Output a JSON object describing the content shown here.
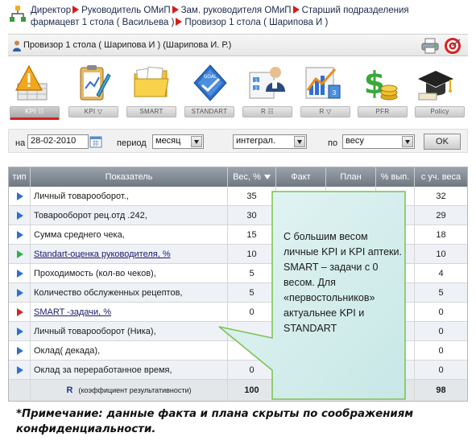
{
  "breadcrumb": {
    "items": [
      "Директор",
      "Руководитель ОМиП",
      "Зам. руководителя ОМиП",
      "Старший подразделения",
      "фармацевт 1 стола ( Васильева )",
      "Провизор 1 стола ( Шарипова И )"
    ]
  },
  "user": {
    "label": "Провизор 1 стола ( Шарипова И )  (Шарипова И. Р.)"
  },
  "modules": [
    "KPI",
    "KPI",
    "SMART",
    "STANDART",
    "R",
    "R",
    "PFR",
    "Policy"
  ],
  "tabs": [
    {
      "label": "KPI ☷",
      "active": true
    },
    {
      "label": "KPI ▽",
      "active": false
    },
    {
      "label": "SMART",
      "active": false
    },
    {
      "label": "STANDART",
      "active": false
    },
    {
      "label": "R ☷",
      "active": false
    },
    {
      "label": "R ▽",
      "active": false
    },
    {
      "label": "PFR",
      "active": false
    },
    {
      "label": "Policy",
      "active": false
    }
  ],
  "filters": {
    "date_label": "на",
    "date_value": "28-02-2010",
    "period_label": "период",
    "period_value": "месяц",
    "mode_value": "интеграл.",
    "by_label": "по",
    "by_value": "весу",
    "ok_label": "OK"
  },
  "table": {
    "headers": [
      "тип",
      "Показатель",
      "Вес, %",
      "Факт",
      "План",
      "% вып.",
      "с уч. веса"
    ],
    "rows": [
      {
        "type": "blue",
        "name": "Личный товарооборот.,",
        "weight": "35",
        "fact": "",
        "plan": "",
        "pct": "",
        "weighted": "32",
        "link": false
      },
      {
        "type": "blue",
        "name": "Товарооборот рец.отд .242,",
        "weight": "30",
        "fact": "",
        "plan": "",
        "pct": "",
        "weighted": "29",
        "link": false
      },
      {
        "type": "blue",
        "name": "Сумма среднего чека,",
        "weight": "15",
        "fact": "",
        "plan": "",
        "pct": "",
        "weighted": "18",
        "link": false
      },
      {
        "type": "green",
        "name": "Standart-оценка руководителя, %",
        "weight": "10",
        "fact": "",
        "plan": "",
        "pct": "",
        "weighted": "10",
        "link": true
      },
      {
        "type": "blue",
        "name": "Проходимость (кол-во чеков),",
        "weight": "5",
        "fact": "",
        "plan": "",
        "pct": "",
        "weighted": "4",
        "link": false
      },
      {
        "type": "blue",
        "name": "Количество обслуженных рецептов,",
        "weight": "5",
        "fact": "",
        "plan": "",
        "pct": "",
        "weighted": "5",
        "link": false
      },
      {
        "type": "red",
        "name": "SMART -задачи, %",
        "weight": "0",
        "fact": "",
        "plan": "",
        "pct": "",
        "weighted": "0",
        "link": true
      },
      {
        "type": "blue",
        "name": "Личный товарооборот (Ника),",
        "weight": "",
        "fact": "",
        "plan": "",
        "pct": "",
        "weighted": "0",
        "link": false
      },
      {
        "type": "blue",
        "name": "Оклад( декада),",
        "weight": "",
        "fact": "",
        "plan": "",
        "pct": "",
        "weighted": "0",
        "link": false
      },
      {
        "type": "blue",
        "name": "Оклад за переработанное время,",
        "weight": "0",
        "fact": "",
        "plan": "",
        "pct": "",
        "weighted": "0",
        "link": false
      }
    ],
    "total": {
      "label_r": "R",
      "label": "(коэффициент результативности)",
      "weight": "100",
      "weighted": "98"
    }
  },
  "callout": {
    "text": "С большим весом личные KPI и KPI аптеки. SMART – задачи с 0 весом. Для «первостольников» актуальнее KPI и STANDART"
  },
  "note": "*Примечание: данные факта и плана скрыты по соображениям конфиденциальности."
}
